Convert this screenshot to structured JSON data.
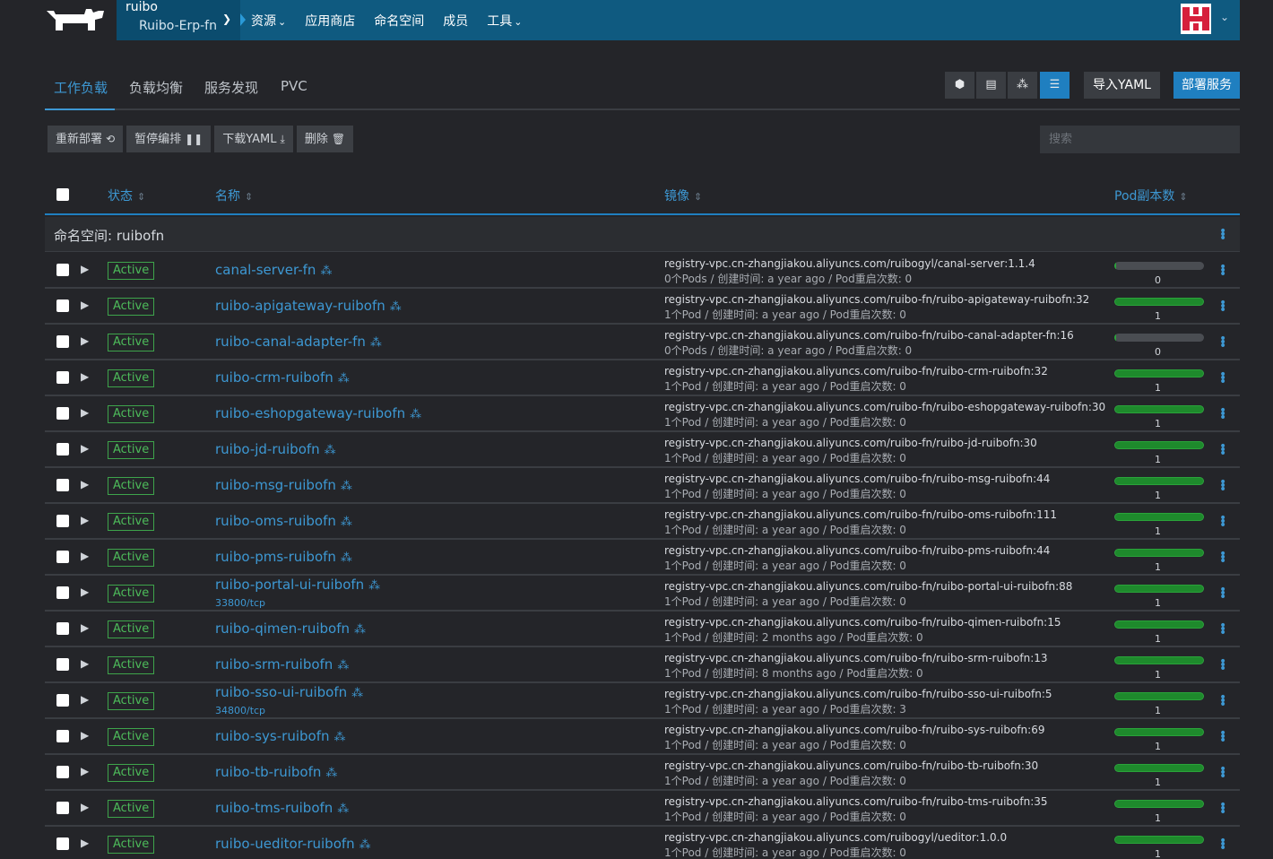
{
  "header": {
    "cluster_name": "ruibo",
    "project_name": "Ruibo-Erp-fn",
    "nav": [
      {
        "label": "资源",
        "dropdown": true
      },
      {
        "label": "应用商店",
        "dropdown": false
      },
      {
        "label": "命名空间",
        "dropdown": false
      },
      {
        "label": "成员",
        "dropdown": false
      },
      {
        "label": "工具",
        "dropdown": true
      }
    ]
  },
  "tabs": [
    "工作负载",
    "负载均衡",
    "服务发现",
    "PVC"
  ],
  "view_buttons": [
    {
      "icon": "cube-icon",
      "glyph": "⬢",
      "active": false
    },
    {
      "icon": "list-icon",
      "glyph": "▤",
      "active": false
    },
    {
      "icon": "cluster-icon",
      "glyph": "⁂",
      "active": false
    },
    {
      "icon": "tree-list-icon",
      "glyph": "☰",
      "active": true
    }
  ],
  "actions": {
    "import_yaml": "导入YAML",
    "deploy": "部署服务"
  },
  "bulk_actions": [
    {
      "label": "重新部署",
      "icon": "⟲",
      "name": "redeploy-button"
    },
    {
      "label": "暂停编排",
      "icon": "❚❚",
      "name": "pause-button"
    },
    {
      "label": "下载YAML",
      "icon": "⤓",
      "name": "download-yaml-button"
    },
    {
      "label": "删除",
      "icon": "🗑",
      "name": "delete-button"
    }
  ],
  "search": {
    "placeholder": "搜索"
  },
  "table": {
    "headers": {
      "state": "状态",
      "name": "名称",
      "image": "镜像",
      "scale": "Pod副本数"
    },
    "namespace_label": "命名空间: ruibofn",
    "rows": [
      {
        "state": "Active",
        "name": "canal-server-fn",
        "port": "",
        "image": "registry-vpc.cn-zhangjiakou.aliyuncs.com/ruibogyl/canal-server:1.1.4",
        "meta": "0个Pods / 创建时间: a year ago / Pod重启次数: 0",
        "scale": 0
      },
      {
        "state": "Active",
        "name": "ruibo-apigateway-ruibofn",
        "port": "",
        "image": "registry-vpc.cn-zhangjiakou.aliyuncs.com/ruibo-fn/ruibo-apigateway-ruibofn:32",
        "meta": "1个Pod / 创建时间: a year ago / Pod重启次数: 0",
        "scale": 1
      },
      {
        "state": "Active",
        "name": "ruibo-canal-adapter-fn",
        "port": "",
        "image": "registry-vpc.cn-zhangjiakou.aliyuncs.com/ruibo-fn/ruibo-canal-adapter-fn:16",
        "meta": "0个Pods / 创建时间: a year ago / Pod重启次数: 0",
        "scale": 0
      },
      {
        "state": "Active",
        "name": "ruibo-crm-ruibofn",
        "port": "",
        "image": "registry-vpc.cn-zhangjiakou.aliyuncs.com/ruibo-fn/ruibo-crm-ruibofn:32",
        "meta": "1个Pod / 创建时间: a year ago / Pod重启次数: 0",
        "scale": 1
      },
      {
        "state": "Active",
        "name": "ruibo-eshopgateway-ruibofn",
        "port": "",
        "image": "registry-vpc.cn-zhangjiakou.aliyuncs.com/ruibo-fn/ruibo-eshopgateway-ruibofn:30",
        "meta": "1个Pod / 创建时间: a year ago / Pod重启次数: 0",
        "scale": 1
      },
      {
        "state": "Active",
        "name": "ruibo-jd-ruibofn",
        "port": "",
        "image": "registry-vpc.cn-zhangjiakou.aliyuncs.com/ruibo-fn/ruibo-jd-ruibofn:30",
        "meta": "1个Pod / 创建时间: a year ago / Pod重启次数: 0",
        "scale": 1
      },
      {
        "state": "Active",
        "name": "ruibo-msg-ruibofn",
        "port": "",
        "image": "registry-vpc.cn-zhangjiakou.aliyuncs.com/ruibo-fn/ruibo-msg-ruibofn:44",
        "meta": "1个Pod / 创建时间: a year ago / Pod重启次数: 0",
        "scale": 1
      },
      {
        "state": "Active",
        "name": "ruibo-oms-ruibofn",
        "port": "",
        "image": "registry-vpc.cn-zhangjiakou.aliyuncs.com/ruibo-fn/ruibo-oms-ruibofn:111",
        "meta": "1个Pod / 创建时间: a year ago / Pod重启次数: 0",
        "scale": 1
      },
      {
        "state": "Active",
        "name": "ruibo-pms-ruibofn",
        "port": "",
        "image": "registry-vpc.cn-zhangjiakou.aliyuncs.com/ruibo-fn/ruibo-pms-ruibofn:44",
        "meta": "1个Pod / 创建时间: a year ago / Pod重启次数: 0",
        "scale": 1
      },
      {
        "state": "Active",
        "name": "ruibo-portal-ui-ruibofn",
        "port": "33800/tcp",
        "image": "registry-vpc.cn-zhangjiakou.aliyuncs.com/ruibo-fn/ruibo-portal-ui-ruibofn:88",
        "meta": "1个Pod / 创建时间: a year ago / Pod重启次数: 0",
        "scale": 1
      },
      {
        "state": "Active",
        "name": "ruibo-qimen-ruibofn",
        "port": "",
        "image": "registry-vpc.cn-zhangjiakou.aliyuncs.com/ruibo-fn/ruibo-qimen-ruibofn:15",
        "meta": "1个Pod / 创建时间: 2 months ago / Pod重启次数: 0",
        "scale": 1
      },
      {
        "state": "Active",
        "name": "ruibo-srm-ruibofn",
        "port": "",
        "image": "registry-vpc.cn-zhangjiakou.aliyuncs.com/ruibo-fn/ruibo-srm-ruibofn:13",
        "meta": "1个Pod / 创建时间: 8 months ago / Pod重启次数: 0",
        "scale": 1
      },
      {
        "state": "Active",
        "name": "ruibo-sso-ui-ruibofn",
        "port": "34800/tcp",
        "image": "registry-vpc.cn-zhangjiakou.aliyuncs.com/ruibo-fn/ruibo-sso-ui-ruibofn:5",
        "meta": "1个Pod / 创建时间: a year ago / Pod重启次数: 3",
        "scale": 1
      },
      {
        "state": "Active",
        "name": "ruibo-sys-ruibofn",
        "port": "",
        "image": "registry-vpc.cn-zhangjiakou.aliyuncs.com/ruibo-fn/ruibo-sys-ruibofn:69",
        "meta": "1个Pod / 创建时间: a year ago / Pod重启次数: 0",
        "scale": 1
      },
      {
        "state": "Active",
        "name": "ruibo-tb-ruibofn",
        "port": "",
        "image": "registry-vpc.cn-zhangjiakou.aliyuncs.com/ruibo-fn/ruibo-tb-ruibofn:30",
        "meta": "1个Pod / 创建时间: a year ago / Pod重启次数: 0",
        "scale": 1
      },
      {
        "state": "Active",
        "name": "ruibo-tms-ruibofn",
        "port": "",
        "image": "registry-vpc.cn-zhangjiakou.aliyuncs.com/ruibo-fn/ruibo-tms-ruibofn:35",
        "meta": "1个Pod / 创建时间: a year ago / Pod重启次数: 0",
        "scale": 1
      },
      {
        "state": "Active",
        "name": "ruibo-ueditor-ruibofn",
        "port": "",
        "image": "registry-vpc.cn-zhangjiakou.aliyuncs.com/ruibogyl/ueditor:1.0.0",
        "meta": "1个Pod / 创建时间: a year ago / Pod重启次数: 0",
        "scale": 1
      }
    ]
  },
  "colors": {
    "accent": "#3d98d3",
    "nav_bg": "#0f5a80",
    "active_green": "#4dbb5a",
    "bg": "#242529"
  }
}
